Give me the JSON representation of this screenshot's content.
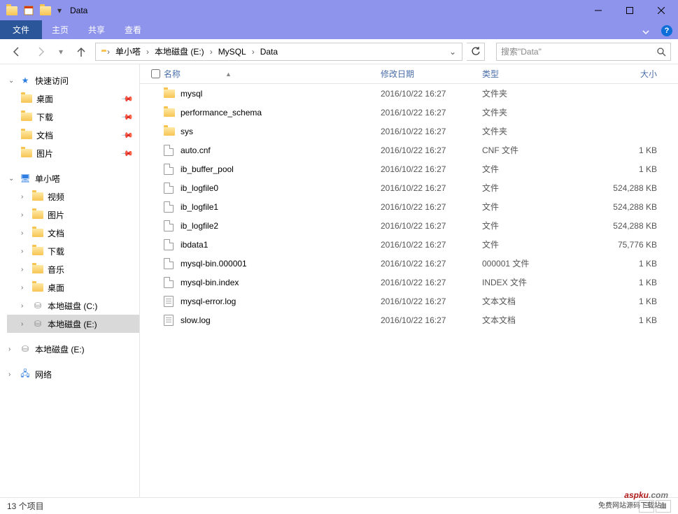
{
  "window": {
    "title": "Data"
  },
  "ribbon": {
    "file": "文件",
    "tabs": [
      "主页",
      "共享",
      "查看"
    ]
  },
  "breadcrumb": {
    "segments": [
      "单小嗒",
      "本地磁盘 (E:)",
      "MySQL",
      "Data"
    ]
  },
  "search": {
    "placeholder": "搜索\"Data\""
  },
  "sidebar": {
    "quick_access": {
      "label": "快速访问",
      "items": [
        {
          "label": "桌面",
          "icon": "folder"
        },
        {
          "label": "下载",
          "icon": "folder"
        },
        {
          "label": "文档",
          "icon": "folder"
        },
        {
          "label": "图片",
          "icon": "folder"
        }
      ]
    },
    "this_pc": {
      "label": "单小嗒",
      "items": [
        {
          "label": "视频",
          "icon": "folder"
        },
        {
          "label": "图片",
          "icon": "folder"
        },
        {
          "label": "文档",
          "icon": "folder"
        },
        {
          "label": "下载",
          "icon": "folder"
        },
        {
          "label": "音乐",
          "icon": "folder"
        },
        {
          "label": "桌面",
          "icon": "folder"
        },
        {
          "label": "本地磁盘 (C:)",
          "icon": "drive"
        },
        {
          "label": "本地磁盘 (E:)",
          "icon": "drive",
          "selected": true
        }
      ]
    },
    "drives": [
      {
        "label": "本地磁盘 (E:)",
        "icon": "drive"
      }
    ],
    "network": {
      "label": "网络"
    }
  },
  "columns": {
    "name": "名称",
    "date": "修改日期",
    "type": "类型",
    "size": "大小"
  },
  "files": [
    {
      "name": "mysql",
      "date": "2016/10/22 16:27",
      "type": "文件夹",
      "size": "",
      "icon": "folder"
    },
    {
      "name": "performance_schema",
      "date": "2016/10/22 16:27",
      "type": "文件夹",
      "size": "",
      "icon": "folder"
    },
    {
      "name": "sys",
      "date": "2016/10/22 16:27",
      "type": "文件夹",
      "size": "",
      "icon": "folder"
    },
    {
      "name": "auto.cnf",
      "date": "2016/10/22 16:27",
      "type": "CNF 文件",
      "size": "1 KB",
      "icon": "file"
    },
    {
      "name": "ib_buffer_pool",
      "date": "2016/10/22 16:27",
      "type": "文件",
      "size": "1 KB",
      "icon": "file"
    },
    {
      "name": "ib_logfile0",
      "date": "2016/10/22 16:27",
      "type": "文件",
      "size": "524,288 KB",
      "icon": "file"
    },
    {
      "name": "ib_logfile1",
      "date": "2016/10/22 16:27",
      "type": "文件",
      "size": "524,288 KB",
      "icon": "file"
    },
    {
      "name": "ib_logfile2",
      "date": "2016/10/22 16:27",
      "type": "文件",
      "size": "524,288 KB",
      "icon": "file"
    },
    {
      "name": "ibdata1",
      "date": "2016/10/22 16:27",
      "type": "文件",
      "size": "75,776 KB",
      "icon": "file"
    },
    {
      "name": "mysql-bin.000001",
      "date": "2016/10/22 16:27",
      "type": "000001 文件",
      "size": "1 KB",
      "icon": "file"
    },
    {
      "name": "mysql-bin.index",
      "date": "2016/10/22 16:27",
      "type": "INDEX 文件",
      "size": "1 KB",
      "icon": "file"
    },
    {
      "name": "mysql-error.log",
      "date": "2016/10/22 16:27",
      "type": "文本文档",
      "size": "1 KB",
      "icon": "textfile"
    },
    {
      "name": "slow.log",
      "date": "2016/10/22 16:27",
      "type": "文本文档",
      "size": "1 KB",
      "icon": "textfile"
    }
  ],
  "status": {
    "count_label": "13 个项目"
  },
  "watermark": {
    "brand": "aspku",
    "tld": ".com",
    "tagline": "免费网站源码下载站！"
  }
}
